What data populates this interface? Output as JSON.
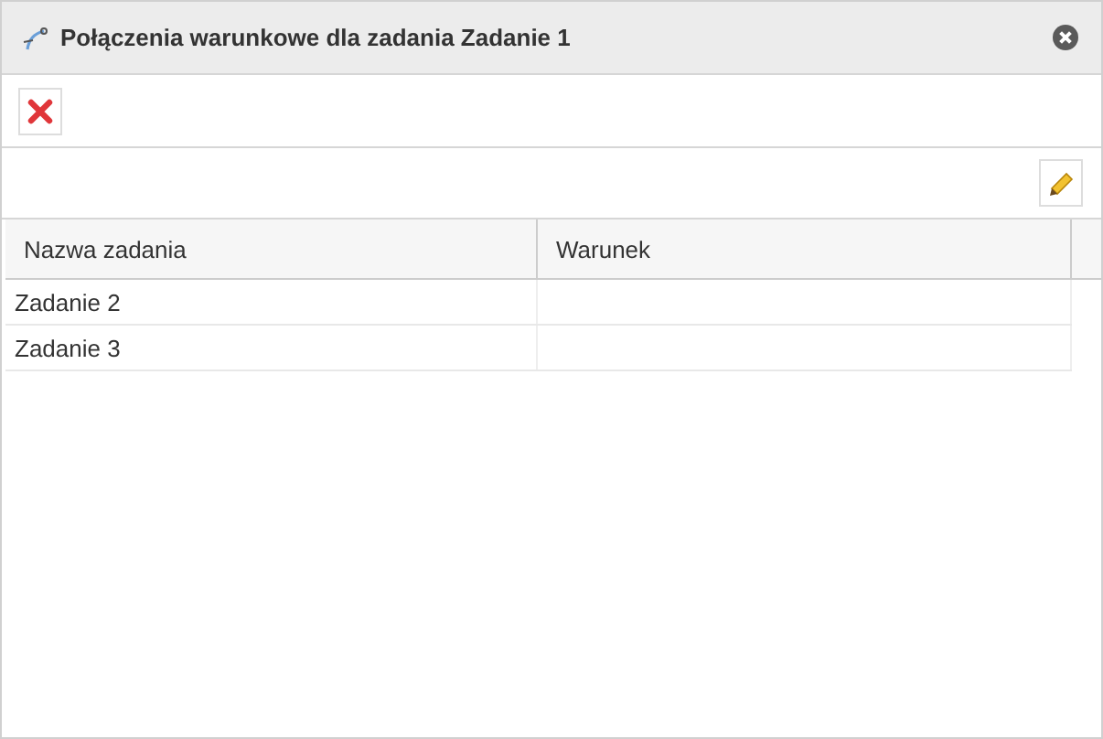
{
  "window": {
    "title": "Połączenia warunkowe dla zadania Zadanie 1"
  },
  "table": {
    "columns": [
      "Nazwa zadania",
      "Warunek"
    ],
    "rows": [
      {
        "task": "Zadanie 2"
      },
      {
        "task": "Zadanie 3"
      }
    ]
  }
}
